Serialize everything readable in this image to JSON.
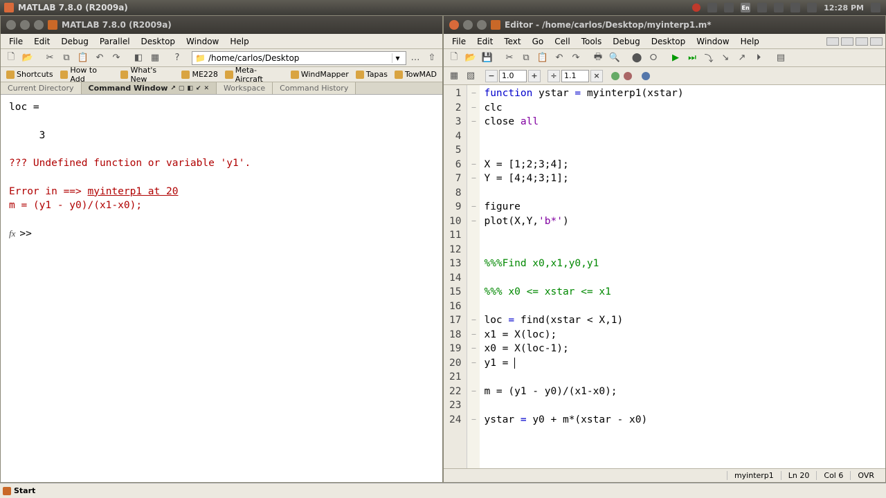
{
  "os_titlebar": {
    "title": "MATLAB  7.8.0 (R2009a)"
  },
  "syspanel": {
    "clock": "12:28 PM"
  },
  "left_window": {
    "title": "MATLAB  7.8.0 (R2009a)",
    "menus": [
      "File",
      "Edit",
      "Debug",
      "Parallel",
      "Desktop",
      "Window",
      "Help"
    ],
    "path": "/home/carlos/Desktop",
    "shortcuts": [
      "Shortcuts",
      "How to Add",
      "What's New",
      "ME228",
      "Meta-Aircraft",
      "WindMapper",
      "Tapas",
      "TowMAD"
    ],
    "tabs": [
      "Current Directory",
      "Command Window",
      "Workspace",
      "Command History"
    ],
    "active_tab": 1,
    "cmd_out": {
      "l1": "loc =",
      "l2": "     3",
      "l3": "??? Undefined function or variable 'y1'.",
      "l4a": "Error in ==> ",
      "l4b": "myinterp1 at 20",
      "l5": "m = (y1 - y0)/(x1-x0);",
      "prompt": ">> "
    }
  },
  "right_window": {
    "title": "Editor - /home/carlos/Desktop/myinterp1.m*",
    "menus": [
      "File",
      "Edit",
      "Text",
      "Go",
      "Cell",
      "Tools",
      "Debug",
      "Desktop",
      "Window",
      "Help"
    ],
    "div1": "1.0",
    "div2": "1.1",
    "code_lines": [
      {
        "n": 1,
        "m": "–",
        "segs": [
          [
            "kw",
            "function"
          ],
          [
            "",
            " ystar "
          ],
          [
            "kw",
            "="
          ],
          [
            "",
            " myinterp1(xstar)"
          ]
        ]
      },
      {
        "n": 2,
        "m": "–",
        "segs": [
          [
            "",
            "clc"
          ]
        ]
      },
      {
        "n": 3,
        "m": "–",
        "segs": [
          [
            "",
            "close "
          ],
          [
            "str",
            "all"
          ]
        ]
      },
      {
        "n": 4,
        "m": "",
        "segs": [
          [
            "",
            ""
          ]
        ]
      },
      {
        "n": 5,
        "m": "",
        "segs": [
          [
            "",
            ""
          ]
        ]
      },
      {
        "n": 6,
        "m": "–",
        "segs": [
          [
            "",
            "X = [1;2;3;4];"
          ]
        ]
      },
      {
        "n": 7,
        "m": "–",
        "segs": [
          [
            "",
            "Y = [4;4;3;1];"
          ]
        ]
      },
      {
        "n": 8,
        "m": "",
        "segs": [
          [
            "",
            ""
          ]
        ]
      },
      {
        "n": 9,
        "m": "–",
        "segs": [
          [
            "",
            "figure"
          ]
        ]
      },
      {
        "n": 10,
        "m": "–",
        "segs": [
          [
            "",
            "plot(X,Y,"
          ],
          [
            "str",
            "'b*'"
          ],
          [
            "",
            ")"
          ]
        ]
      },
      {
        "n": 11,
        "m": "",
        "segs": [
          [
            "",
            ""
          ]
        ]
      },
      {
        "n": 12,
        "m": "",
        "segs": [
          [
            "",
            ""
          ]
        ]
      },
      {
        "n": 13,
        "m": "",
        "segs": [
          [
            "cmt",
            "%%%Find x0,x1,y0,y1"
          ]
        ]
      },
      {
        "n": 14,
        "m": "",
        "segs": [
          [
            "",
            ""
          ]
        ]
      },
      {
        "n": 15,
        "m": "",
        "segs": [
          [
            "cmt",
            "%%% x0 <= xstar <= x1"
          ]
        ]
      },
      {
        "n": 16,
        "m": "",
        "segs": [
          [
            "",
            ""
          ]
        ]
      },
      {
        "n": 17,
        "m": "–",
        "segs": [
          [
            "",
            "loc "
          ],
          [
            "kw",
            "="
          ],
          [
            "",
            " find(xstar < X,1)"
          ]
        ]
      },
      {
        "n": 18,
        "m": "–",
        "segs": [
          [
            "",
            "x1 = X(loc);"
          ]
        ]
      },
      {
        "n": 19,
        "m": "–",
        "segs": [
          [
            "",
            "x0 = X(loc-1);"
          ]
        ]
      },
      {
        "n": 20,
        "m": "–",
        "segs": [
          [
            "",
            "y1 = "
          ]
        ],
        "cursor": true
      },
      {
        "n": 21,
        "m": "",
        "segs": [
          [
            "",
            ""
          ]
        ]
      },
      {
        "n": 22,
        "m": "–",
        "segs": [
          [
            "",
            "m = (y1 - y0)/(x1-x0);"
          ]
        ]
      },
      {
        "n": 23,
        "m": "",
        "segs": [
          [
            "",
            ""
          ]
        ]
      },
      {
        "n": 24,
        "m": "–",
        "segs": [
          [
            "",
            "ystar "
          ],
          [
            "kw",
            "="
          ],
          [
            "",
            " y0 + m*(xstar - x0)"
          ]
        ]
      }
    ],
    "status": {
      "file": "myinterp1",
      "ln": "Ln  20",
      "col": "Col  6",
      "ovr": "OVR"
    }
  },
  "taskbar": {
    "start": "Start"
  }
}
